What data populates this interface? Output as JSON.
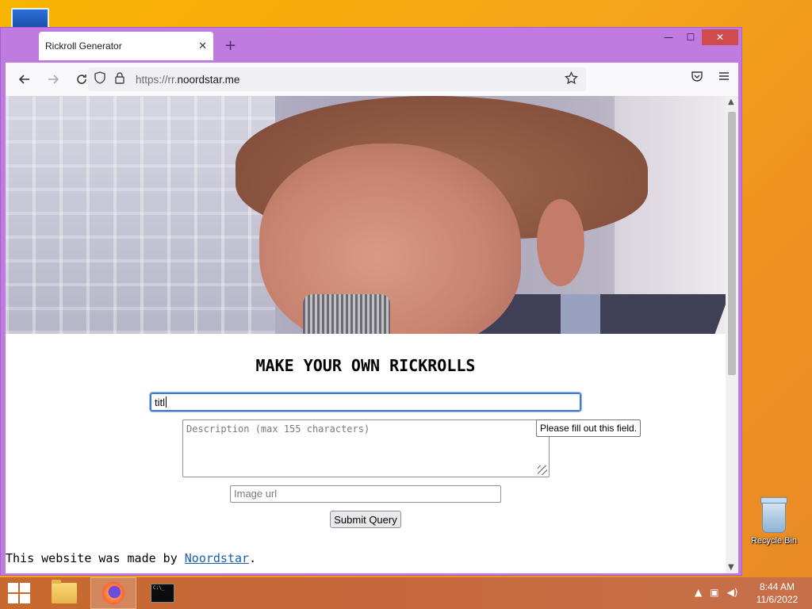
{
  "desktop": {
    "recycle_bin_label": "Recycle Bin"
  },
  "window": {
    "controls": {
      "minimize": "—",
      "maximize": "☐",
      "close": "✕"
    }
  },
  "tab": {
    "title": "Rickroll Generator",
    "close": "✕",
    "new_tab": "+"
  },
  "navbar": {
    "url_scheme": "https://rr.",
    "url_host": "noordstar.me"
  },
  "page": {
    "heading": "MAKE YOUR OWN RICKROLLS",
    "title_value": "titl",
    "description_placeholder": "Description (max 155 characters)",
    "image_placeholder": "Image url",
    "submit_label": "Submit Query",
    "tooltip": "Please fill out this field.",
    "footer_prefix": "This website was made by ",
    "footer_link": "Noordstar",
    "footer_suffix": "."
  },
  "taskbar": {
    "time": "8:44 AM",
    "date": "11/6/2022"
  },
  "colors": {
    "window_frame": "#c07be0",
    "focus_ring": "#3b7bd4",
    "link": "#1a5fa8"
  }
}
